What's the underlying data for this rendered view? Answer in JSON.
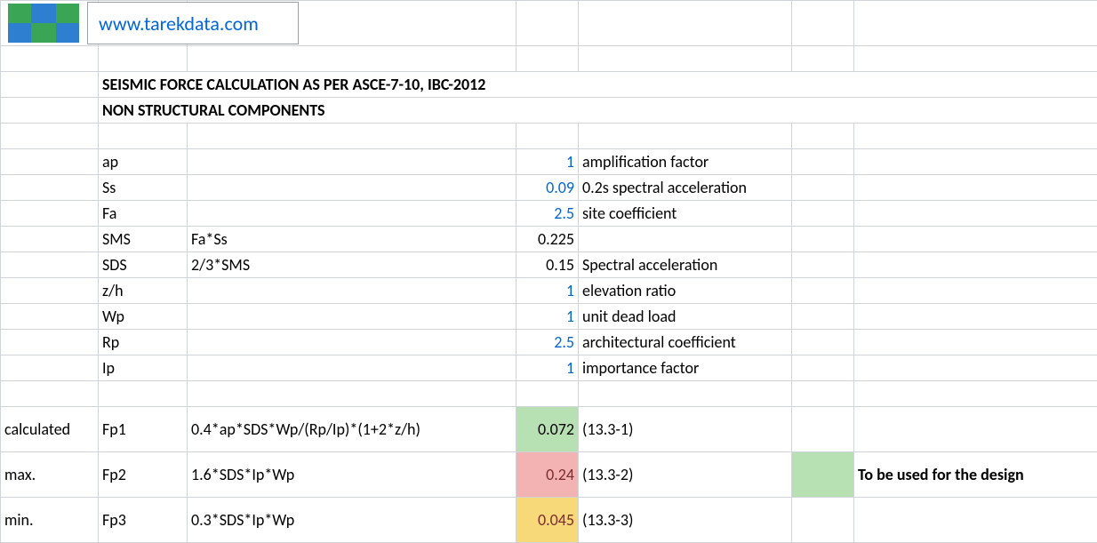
{
  "header": {
    "url": "www.tarekdata.com",
    "title_line1": "SEISMIC FORCE CALCULATION AS PER ASCE-7-10, IBC-2012",
    "title_line2": "NON STRUCTURAL COMPONENTS"
  },
  "params": [
    {
      "sym": "ap",
      "formula": "",
      "value": "1",
      "blue": true,
      "desc": "amplification factor"
    },
    {
      "sym": "Ss",
      "formula": "",
      "value": "0.09",
      "blue": true,
      "desc": "0.2s spectral acceleration"
    },
    {
      "sym": "Fa",
      "formula": "",
      "value": "2.5",
      "blue": true,
      "desc": "site coefficient"
    },
    {
      "sym": "SMS",
      "formula": "Fa*Ss",
      "value": "0.225",
      "blue": false,
      "desc": ""
    },
    {
      "sym": "SDS",
      "formula": "2/3*SMS",
      "value": "0.15",
      "blue": false,
      "desc": "Spectral acceleration"
    },
    {
      "sym": "z/h",
      "formula": "",
      "value": "1",
      "blue": true,
      "desc": "elevation ratio"
    },
    {
      "sym": "Wp",
      "formula": "",
      "value": "1",
      "blue": true,
      "desc": "unit dead load"
    },
    {
      "sym": "Rp",
      "formula": "",
      "value": "2.5",
      "blue": true,
      "desc": "architectural coefficient"
    },
    {
      "sym": "Ip",
      "formula": "",
      "value": "1",
      "blue": true,
      "desc": "importance factor"
    }
  ],
  "results": {
    "fp1": {
      "label": "calculated",
      "sym": "Fp1",
      "formula": "0.4*ap*SDS*Wp/(Rp/Ip)*(1+2*z/h)",
      "value": "0.072",
      "ref": "(13.3-1)"
    },
    "fp2": {
      "label": "max.",
      "sym": "Fp2",
      "formula": "1.6*SDS*Ip*Wp",
      "value": "0.24",
      "ref": "(13.3-2)"
    },
    "fp3": {
      "label": "min.",
      "sym": "Fp3",
      "formula": "0.3*SDS*Ip*Wp",
      "value": "0.045",
      "ref": "(13.3-3)"
    }
  },
  "note": "To be used for the design"
}
